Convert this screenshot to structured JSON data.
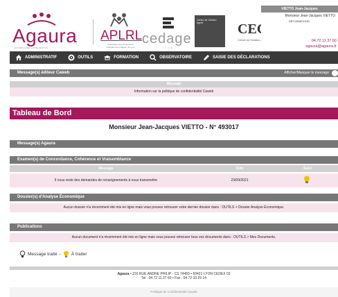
{
  "header": {
    "logos": {
      "agaura": "Agaura",
      "agaura_tagline": "ACCOMPAGNER VOTRE GESTION",
      "aplrl": "APLRL",
      "aplrl_sub": "Association des Professions Libérales de la Région de Lyon",
      "cedage": "cedage",
      "cedage_sub": "LYON",
      "centre": "Centre de Gestion Agréé",
      "cega": "CEGA",
      "cega_sub": "Centre de Gestion Agréé des Taxis"
    },
    "user": {
      "title": "VIETTO Jean-Jacques",
      "name": "Monsieur Jean-Jacques VIETTO",
      "deconnexion": "DÉCONNEXION",
      "phone": "04.72.11.37.60",
      "email": "agaura@agaura.fr"
    }
  },
  "nav": {
    "items": [
      {
        "label": "ADMINISTRATIF",
        "icon": "home-icon"
      },
      {
        "label": "OUTILS",
        "icon": "gear-icon"
      },
      {
        "label": "FORMATION",
        "icon": "graduation-icon"
      },
      {
        "label": "OBSERVATOIRE",
        "icon": "search-icon"
      },
      {
        "label": "SAISIE DES DÉCLARATIONS",
        "icon": "pen-icon"
      }
    ]
  },
  "messages_editor": {
    "title": "Message(s) éditeur Caweb",
    "toggle_label": "Afficher/Masquer le message",
    "column": "Message",
    "row": "Information sur la politique de confidentialité Caweb"
  },
  "tableau": {
    "title": "Tableau de Bord",
    "client": "Monsieur Jean-Jacques VIETTO - N° 493017"
  },
  "messages_agaura": {
    "title": "Message(s) Agaura"
  },
  "examens": {
    "title": "Examen(s) de Concordance, Cohérence et Vraisemblance",
    "columns": [
      "Message",
      "Date",
      "Suivi"
    ],
    "rows": [
      {
        "message": "Il vous reste des demandes de renseignements à nous transmettre",
        "date": "23/09/2021",
        "suivi": "bulb-icon"
      }
    ]
  },
  "dossiers": {
    "title": "Dossier(s) d'Analyse Économique",
    "text": "Aucun dossier n'a récemment été mis en ligne mais vous pouvez retrouver votre dernier dossier dans : OUTILS > Dossier Analyse Économique."
  },
  "publications": {
    "title": "Publications",
    "text": "Aucun document n'a récemment été mis en ligne mais vous pouvez retrouver tous vos documents dans : OUTILS > Mes Documents."
  },
  "legend": {
    "treated": "Message traité",
    "todo": "À traiter",
    "sep": "-"
  },
  "footer": {
    "brand": "Agaura",
    "address": " • 216 RUE ANDRE PHILIP - CS 74459 • 69421 LYON CEDEX 03",
    "contact": "Tel : 04 72 11 37 60 • Fax : 04 72 33 29 14",
    "policy": "Politique de confidentialité Caweb"
  },
  "colors": {
    "brand": "#a3195b",
    "nav_bg": "#3a3a3a",
    "section_bar": "#777777",
    "pink_row": "#f7e3ec",
    "bulb": "#f2c200"
  }
}
